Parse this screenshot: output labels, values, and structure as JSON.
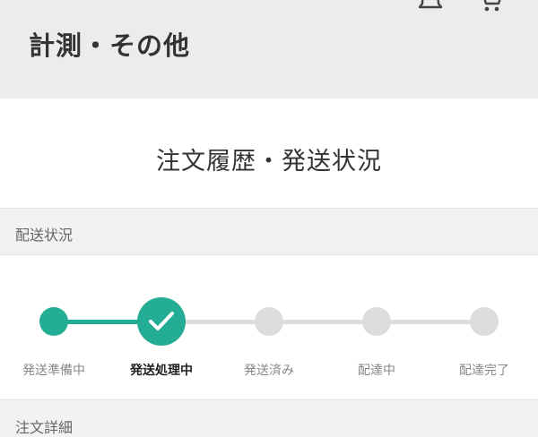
{
  "header": {
    "title": "計測・その他",
    "icons": [
      "bell-icon",
      "cart-icon"
    ]
  },
  "page": {
    "title": "注文履歴・発送状況"
  },
  "sections": {
    "shipping_status": "配送状況",
    "order_details": "注文詳細"
  },
  "progress": {
    "steps": [
      {
        "label": "発送準備中",
        "state": "done"
      },
      {
        "label": "発送処理中",
        "state": "current"
      },
      {
        "label": "発送済み",
        "state": "todo"
      },
      {
        "label": "配達中",
        "state": "todo"
      },
      {
        "label": "配達完了",
        "state": "todo"
      }
    ],
    "current_index": 1
  },
  "colors": {
    "accent": "#23ad95",
    "inactive": "#dddddd",
    "header_bg": "#ececec"
  }
}
